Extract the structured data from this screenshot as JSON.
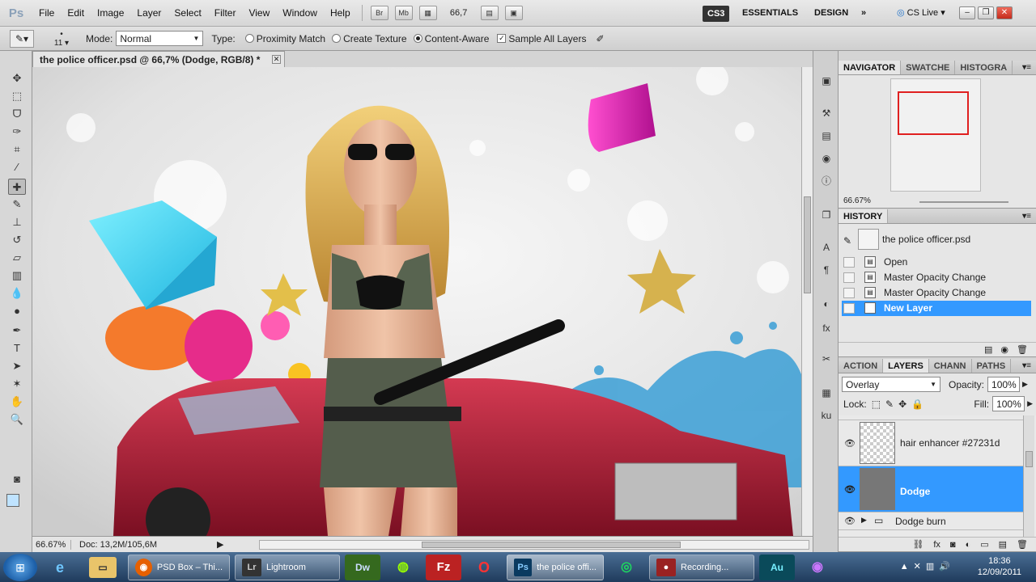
{
  "menubar": {
    "logo": "Ps",
    "items": [
      "File",
      "Edit",
      "Image",
      "Layer",
      "Select",
      "Filter",
      "View",
      "Window",
      "Help"
    ],
    "bridge": "Br",
    "minibridge": "Mb",
    "zoom": "66,7",
    "cs_badge": "CS3",
    "workspace_essentials": "ESSENTIALS",
    "workspace_design": "DESIGN",
    "more": "»",
    "cs_live": "CS Live"
  },
  "options": {
    "brush_size": "11",
    "mode_label": "Mode:",
    "mode_value": "Normal",
    "type_label": "Type:",
    "type_proximity": "Proximity Match",
    "type_texture": "Create Texture",
    "type_content": "Content-Aware",
    "sample_all": "Sample All Layers"
  },
  "document": {
    "tab_title": "the police officer.psd @ 66,7% (Dodge, RGB/8) *",
    "status_zoom": "66.67%",
    "status_doc": "Doc: 13,2M/105,6M"
  },
  "navigator": {
    "tabs": [
      "NAVIGATOR",
      "SWATCHE",
      "HISTOGRA"
    ],
    "zoom": "66.67%"
  },
  "history": {
    "tab": "HISTORY",
    "snapshot": "the police officer.psd",
    "states": [
      "Open",
      "Master Opacity Change",
      "Master Opacity Change",
      "New Layer"
    ]
  },
  "layers": {
    "tabs": [
      "ACTION",
      "LAYERS",
      "CHANN",
      "PATHS"
    ],
    "blend": "Overlay",
    "opacity_label": "Opacity:",
    "opacity": "100%",
    "lock_label": "Lock:",
    "fill_label": "Fill:",
    "fill": "100%",
    "items": [
      "hair enhancer #27231d",
      "Dodge",
      "Dodge burn"
    ]
  },
  "taskbar": {
    "tasks": [
      "PSD Box – Thi...",
      "Lightroom",
      "the police offi...",
      "Recording..."
    ],
    "app_dw": "Dw",
    "app_au": "Au",
    "time": "18:36",
    "date": "12/09/2011"
  },
  "colors": {
    "selection": "#3399ff",
    "fg_swatch": "#bfe3ff"
  }
}
